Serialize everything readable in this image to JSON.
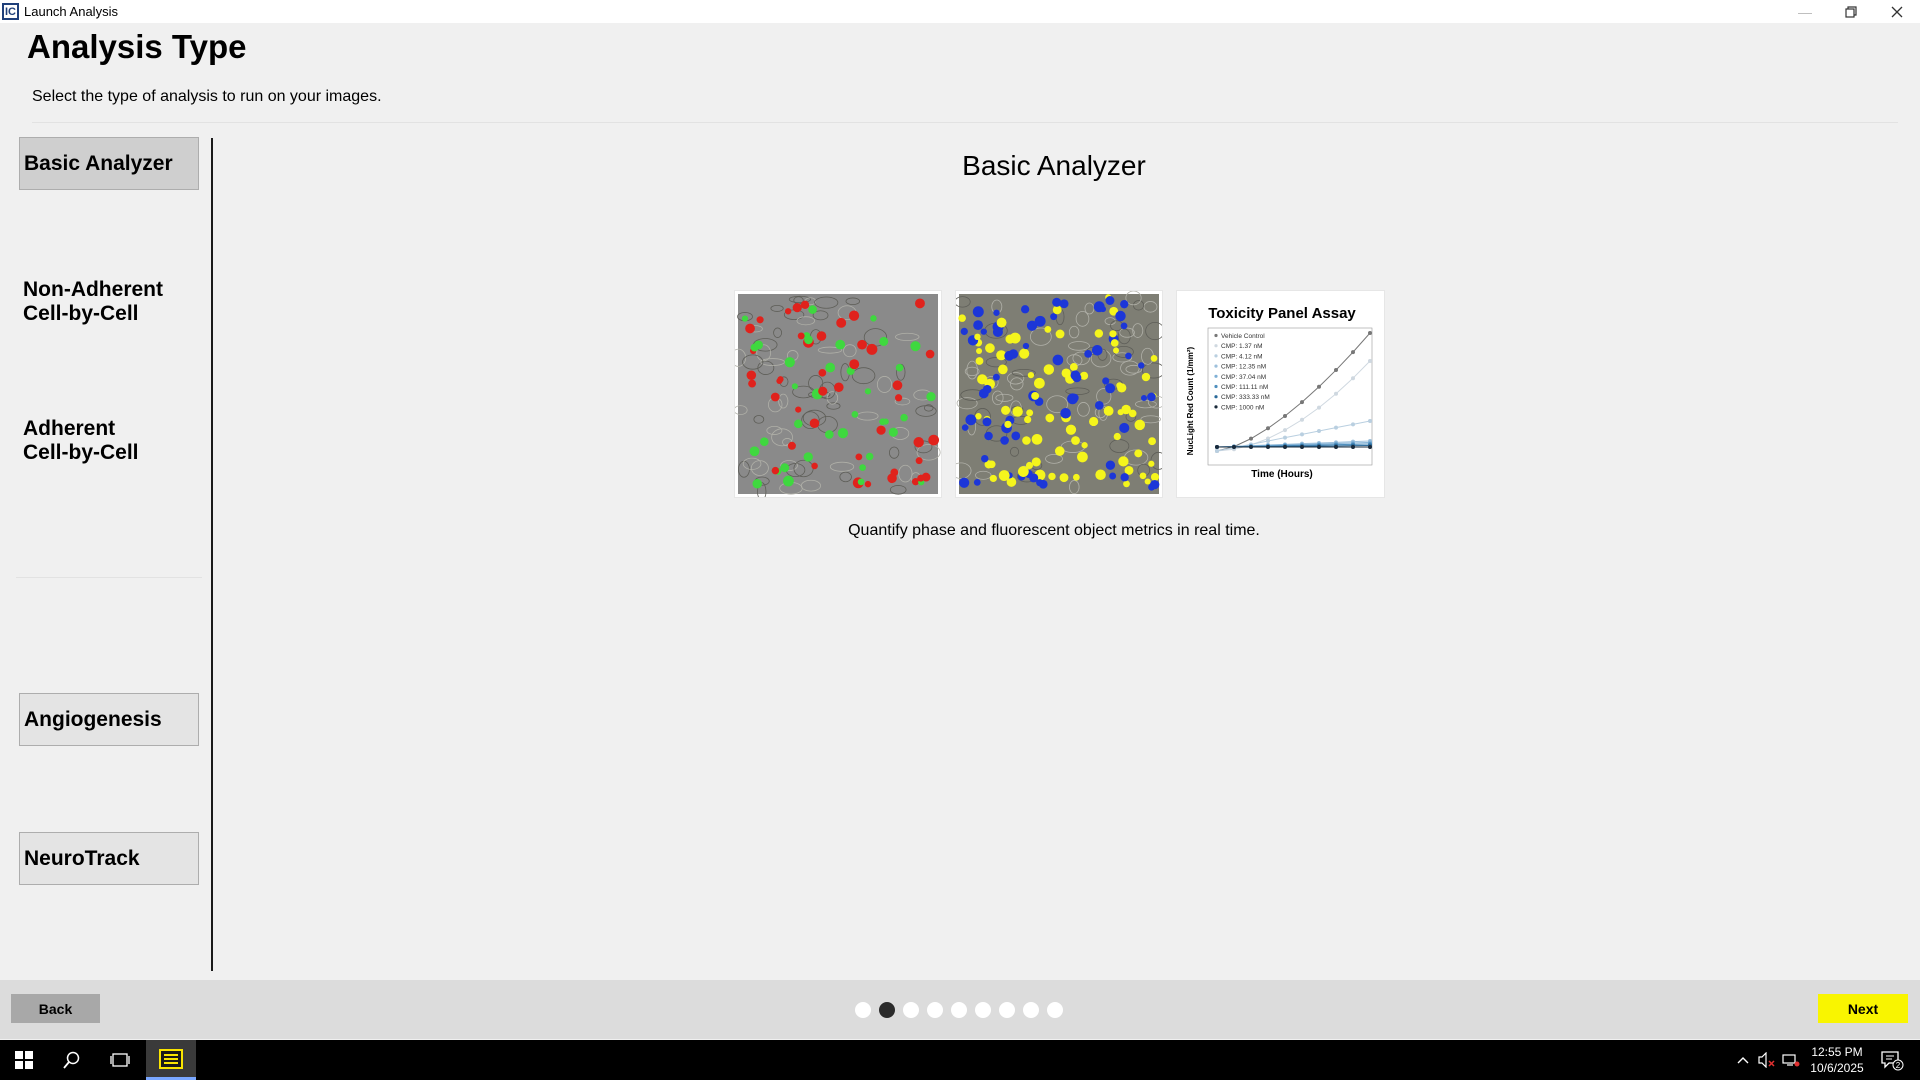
{
  "window": {
    "title": "Launch Analysis",
    "icon_text": "IC"
  },
  "header": {
    "title": "Analysis Type",
    "subtitle": "Select the type of analysis to run on your images."
  },
  "nav": {
    "items": [
      {
        "label": "Basic Analyzer",
        "selected": true
      },
      {
        "label_line1": "Non-Adherent",
        "label_line2": "Cell-by-Cell"
      },
      {
        "label_line1": "Adherent",
        "label_line2": "Cell-by-Cell"
      },
      {
        "label": "Angiogenesis"
      },
      {
        "label": "NeuroTrack"
      }
    ]
  },
  "content": {
    "title": "Basic Analyzer",
    "description": "Quantify phase and fluorescent object metrics in real time.",
    "chart_thumb": {
      "title": "Toxicity Panel Assay",
      "xlabel": "Time (Hours)",
      "ylabel": "NucLight Red Count (1/mm²)",
      "legend": [
        "Vehicle Control",
        "CMP: 1.37 nM",
        "CMP: 4.12 nM",
        "CMP: 12.35 nM",
        "CMP: 37.04 nM",
        "CMP: 111.11 nM",
        "CMP: 333.33 nM",
        "CMP: 1000 nM"
      ]
    }
  },
  "footer": {
    "back_label": "Back",
    "next_label": "Next",
    "steps_total": 9,
    "steps_active": 2
  },
  "taskbar": {
    "time": "12:55 PM",
    "date": "10/6/2025",
    "notification_count": "2"
  },
  "colors": {
    "next_button": "#f9f500",
    "selected_nav": "#cfcfcf",
    "fluor_red": "#e0221c",
    "fluor_green": "#3fd83f",
    "fluor_yellow": "#f5f51c",
    "fluor_blue": "#1c36d8"
  }
}
